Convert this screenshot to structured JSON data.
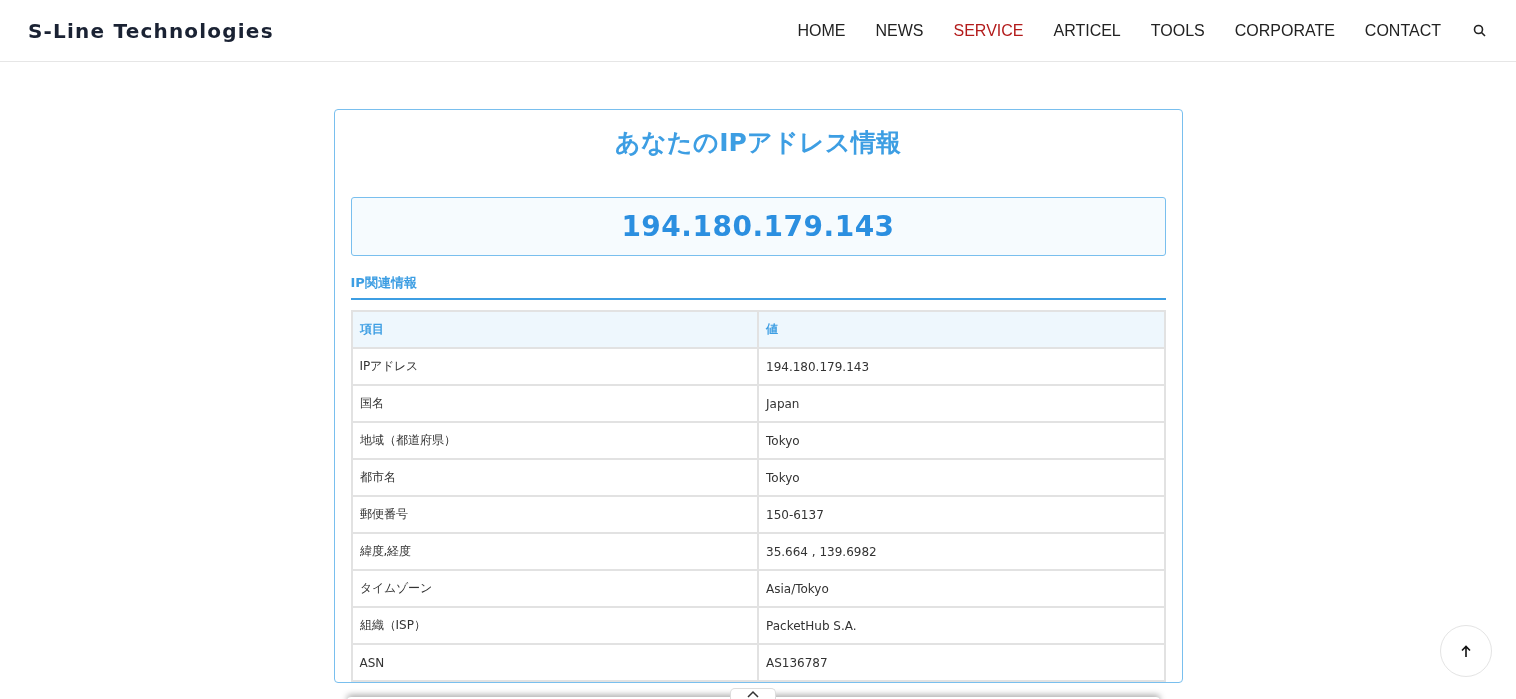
{
  "header": {
    "logo": "S-Line Technologies",
    "nav": [
      {
        "label": "HOME",
        "selected": false
      },
      {
        "label": "NEWS",
        "selected": false
      },
      {
        "label": "SERVICE",
        "selected": true
      },
      {
        "label": "ARTICEL",
        "selected": false
      },
      {
        "label": "TOOLS",
        "selected": false
      },
      {
        "label": "CORPORATE",
        "selected": false
      },
      {
        "label": "CONTACT",
        "selected": false
      }
    ]
  },
  "card": {
    "title": "あなたのIPアドレス情報",
    "ip": "194.180.179.143",
    "section_heading": "IP関連情報",
    "table": {
      "columns": [
        "項目",
        "値"
      ],
      "rows": [
        [
          "IPアドレス",
          "194.180.179.143"
        ],
        [
          "国名",
          "Japan"
        ],
        [
          "地域（都道府県）",
          "Tokyo"
        ],
        [
          "都市名",
          "Tokyo"
        ],
        [
          "郵便番号",
          "150-6137"
        ],
        [
          "緯度,経度",
          "35.664 , 139.6982"
        ],
        [
          "タイムゾーン",
          "Asia/Tokyo"
        ],
        [
          "組織（ISP）",
          "PacketHub S.A."
        ],
        [
          "ASN",
          "AS136787"
        ]
      ]
    }
  }
}
